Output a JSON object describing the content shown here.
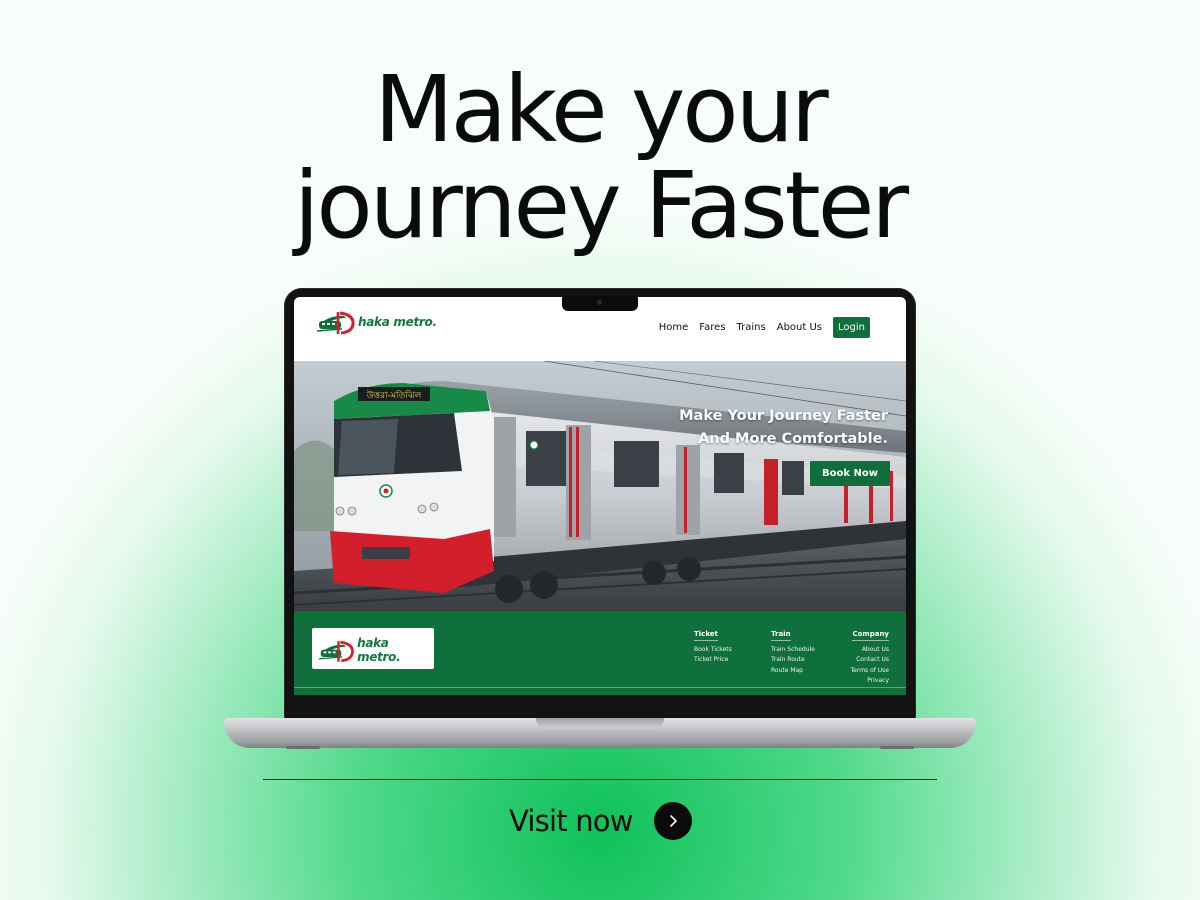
{
  "headline": {
    "line1": "Make your",
    "line2": "journey Faster"
  },
  "site": {
    "logo": {
      "letter_mark": "D",
      "word1": "haka",
      "word2": "metro."
    },
    "nav": {
      "items": [
        {
          "label": "Home"
        },
        {
          "label": "Fares"
        },
        {
          "label": "Trains"
        },
        {
          "label": "About Us"
        }
      ],
      "login_label": "Login"
    },
    "hero": {
      "heading_line1": "Make Your Journey Faster",
      "heading_line2": "And More Comfortable.",
      "book_label": "Book Now",
      "train_sign": "উত্তরা-মতিঝিল"
    },
    "footer": {
      "columns": [
        {
          "title": "Ticket",
          "links": [
            "Book Tickets",
            "Ticket Price"
          ]
        },
        {
          "title": "Train",
          "links": [
            "Train Schedule",
            "Train Route",
            "Route Map"
          ]
        },
        {
          "title": "Company",
          "links": [
            "About Us",
            "Contact Us",
            "Terms of Use",
            "Privacy"
          ]
        }
      ]
    }
  },
  "cta": {
    "label": "Visit now",
    "icon": "chevron-right-icon"
  },
  "colors": {
    "brand_green": "#10703c",
    "brand_red": "#d21f2b",
    "background_green": "#0fc15a",
    "ink": "#0b0b0b"
  }
}
